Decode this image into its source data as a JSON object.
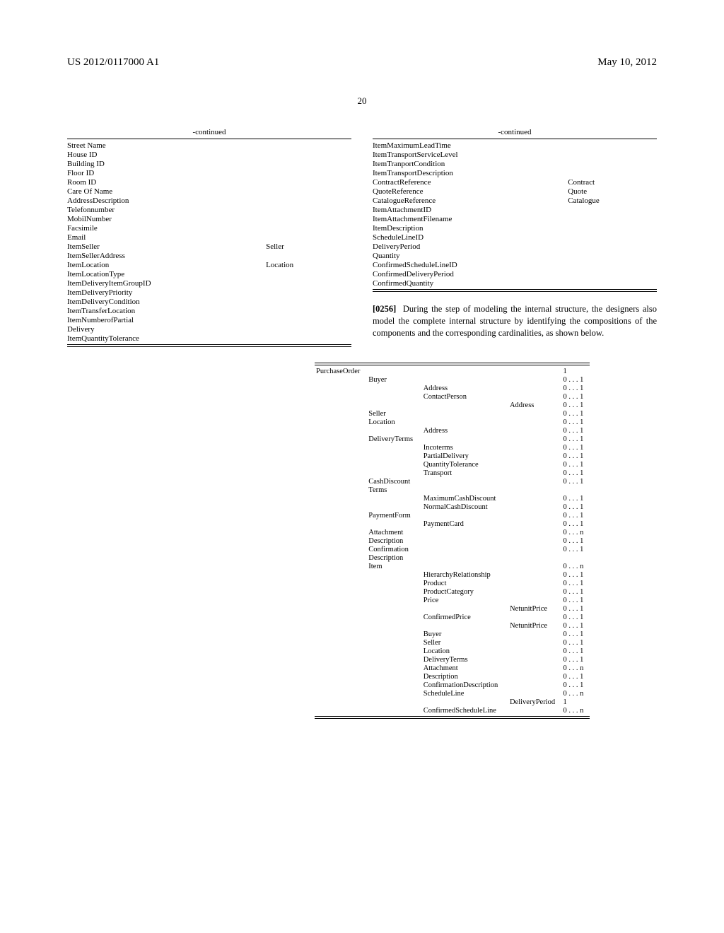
{
  "header": {
    "pub_number": "US 2012/0117000 A1",
    "pub_date": "May 10, 2012"
  },
  "page_number": "20",
  "left_col": {
    "title": "-continued",
    "rows": [
      [
        "Street Name",
        ""
      ],
      [
        "House ID",
        ""
      ],
      [
        "Building ID",
        ""
      ],
      [
        "Floor ID",
        ""
      ],
      [
        "Room ID",
        ""
      ],
      [
        "Care Of Name",
        ""
      ],
      [
        "AddressDescription",
        ""
      ],
      [
        "Telefonnumber",
        ""
      ],
      [
        "MobilNumber",
        ""
      ],
      [
        "Facsimile",
        ""
      ],
      [
        "Email",
        ""
      ],
      [
        "ItemSeller",
        "Seller"
      ],
      [
        "ItemSellerAddress",
        ""
      ],
      [
        "ItemLocation",
        "Location"
      ],
      [
        "ItemLocationType",
        ""
      ],
      [
        "ItemDeliveryItemGroupID",
        ""
      ],
      [
        "ItemDeliveryPriority",
        ""
      ],
      [
        "ItemDeliveryCondition",
        ""
      ],
      [
        "ItemTransferLocation",
        ""
      ],
      [
        "ItemNumberofPartial",
        ""
      ],
      [
        "Delivery",
        ""
      ],
      [
        "ItemQuantityTolerance",
        ""
      ]
    ]
  },
  "right_col": {
    "title": "-continued",
    "rows": [
      [
        "ItemMaximumLeadTime",
        ""
      ],
      [
        "ItemTransportServiceLevel",
        ""
      ],
      [
        "ItemTranportCondition",
        ""
      ],
      [
        "ItemTransportDescription",
        ""
      ],
      [
        "ContractReference",
        "Contract"
      ],
      [
        "QuoteReference",
        "Quote"
      ],
      [
        "CatalogueReference",
        "Catalogue"
      ],
      [
        "ItemAttachmentID",
        ""
      ],
      [
        "ItemAttachmentFilename",
        ""
      ],
      [
        "ItemDescription",
        ""
      ],
      [
        "ScheduleLineID",
        ""
      ],
      [
        "DeliveryPeriod",
        ""
      ],
      [
        "Quantity",
        ""
      ],
      [
        "ConfirmedScheduleLineID",
        ""
      ],
      [
        "ConfirmedDeliveryPeriod",
        ""
      ],
      [
        "ConfirmedQuantity",
        ""
      ]
    ],
    "para_num": "[0256]",
    "para_text": "During the step of modeling the internal structure, the designers also model the complete internal structure by identifying the compositions of the components and the corresponding cardinalities, as shown below."
  },
  "structure": [
    [
      "PurchaseOrder",
      "",
      "",
      "",
      "1"
    ],
    [
      "",
      "Buyer",
      "",
      "",
      "0 . . . 1"
    ],
    [
      "",
      "",
      "Address",
      "",
      "0 . . . 1"
    ],
    [
      "",
      "",
      "ContactPerson",
      "",
      "0 . . . 1"
    ],
    [
      "",
      "",
      "",
      "Address",
      "0 . . . 1"
    ],
    [
      "",
      "Seller",
      "",
      "",
      "0 . . . 1"
    ],
    [
      "",
      "Location",
      "",
      "",
      "0 . . . 1"
    ],
    [
      "",
      "",
      "Address",
      "",
      "0 . . . 1"
    ],
    [
      "",
      "DeliveryTerms",
      "",
      "",
      "0 . . . 1"
    ],
    [
      "",
      "",
      "Incoterms",
      "",
      "0 . . . 1"
    ],
    [
      "",
      "",
      "PartialDelivery",
      "",
      "0 . . . 1"
    ],
    [
      "",
      "",
      "QuantityTolerance",
      "",
      "0 . . . 1"
    ],
    [
      "",
      "",
      "Transport",
      "",
      "0 . . . 1"
    ],
    [
      "",
      "CashDiscount",
      "",
      "",
      "0 . . . 1"
    ],
    [
      "",
      "Terms",
      "",
      "",
      ""
    ],
    [
      "",
      "",
      "MaximumCashDiscount",
      "",
      "0 . . . 1"
    ],
    [
      "",
      "",
      "NormalCashDiscount",
      "",
      "0 . . . 1"
    ],
    [
      "",
      "PaymentForm",
      "",
      "",
      "0 . . . 1"
    ],
    [
      "",
      "",
      "PaymentCard",
      "",
      "0 . . . 1"
    ],
    [
      "",
      "Attachment",
      "",
      "",
      "0 . . . n"
    ],
    [
      "",
      "Description",
      "",
      "",
      "0 . . . 1"
    ],
    [
      "",
      "Confirmation",
      "",
      "",
      "0 . . . 1"
    ],
    [
      "",
      "Description",
      "",
      "",
      ""
    ],
    [
      "",
      "Item",
      "",
      "",
      "0 . . . n"
    ],
    [
      "",
      "",
      "HierarchyRelationship",
      "",
      "0 . . . 1"
    ],
    [
      "",
      "",
      "Product",
      "",
      "0 . . . 1"
    ],
    [
      "",
      "",
      "ProductCategory",
      "",
      "0 . . . 1"
    ],
    [
      "",
      "",
      "Price",
      "",
      "0 . . . 1"
    ],
    [
      "",
      "",
      "",
      "NetunitPrice",
      "0 . . . 1"
    ],
    [
      "",
      "",
      "ConfirmedPrice",
      "",
      "0 . . . 1"
    ],
    [
      "",
      "",
      "",
      "NetunitPrice",
      "0 . . . 1"
    ],
    [
      "",
      "",
      "Buyer",
      "",
      "0 . . . 1"
    ],
    [
      "",
      "",
      "Seller",
      "",
      "0 . . . 1"
    ],
    [
      "",
      "",
      "Location",
      "",
      "0 . . . 1"
    ],
    [
      "",
      "",
      "DeliveryTerms",
      "",
      "0 . . . 1"
    ],
    [
      "",
      "",
      "Attachment",
      "",
      "0 . . . n"
    ],
    [
      "",
      "",
      "Description",
      "",
      "0 . . . 1"
    ],
    [
      "",
      "",
      "ConfirmationDescription",
      "",
      "0 . . . 1"
    ],
    [
      "",
      "",
      "ScheduleLine",
      "",
      "0 . . . n"
    ],
    [
      "",
      "",
      "",
      "DeliveryPeriod",
      "1"
    ],
    [
      "",
      "",
      "ConfirmedScheduleLine",
      "",
      "0 . . . n"
    ]
  ]
}
